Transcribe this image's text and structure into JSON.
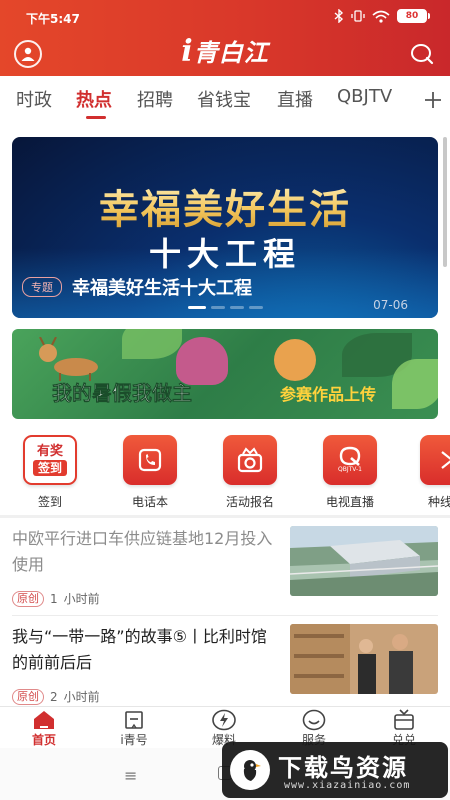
{
  "status_bar": {
    "time": "下午5:47",
    "battery": "80"
  },
  "header": {
    "logo_text": "青白江",
    "logo_prefix": "i"
  },
  "tabs": [
    {
      "label": "时政",
      "active": false
    },
    {
      "label": "热点",
      "active": true
    },
    {
      "label": "招聘",
      "active": false
    },
    {
      "label": "省钱宝",
      "active": false
    },
    {
      "label": "直播",
      "active": false
    },
    {
      "label": "QBJTV",
      "active": false
    }
  ],
  "banner": {
    "headline_line1": "幸福美好生活",
    "headline_line2": "十大工程",
    "tag": "专题",
    "caption": "幸福美好生活十大工程",
    "date": "07-06"
  },
  "promo": {
    "title": "我的暑假我做主",
    "subtitle": "参赛作品上传"
  },
  "quick_entries": [
    {
      "label": "签到",
      "icon": "reward-checkin-icon",
      "icon_top": "有奖",
      "icon_bottom": "签到"
    },
    {
      "label": "电话本",
      "icon": "phonebook-icon"
    },
    {
      "label": "活动报名",
      "icon": "activity-signup-icon"
    },
    {
      "label": "电视直播",
      "icon": "tv-live-icon",
      "icon_text": "QBJTV-1"
    },
    {
      "label": "种线",
      "icon": "more-icon"
    }
  ],
  "news": [
    {
      "headline": "中欧平行进口车供应链基地12月投入使用",
      "tag": "原创",
      "comments": "1",
      "time": "小时前",
      "read": true
    },
    {
      "headline": "我与“一带一路”的故事⑤丨比利时馆的前前后后",
      "tag": "原创",
      "comments": "2",
      "time": "小时前",
      "read": false
    }
  ],
  "bottom_nav": [
    {
      "label": "首页",
      "icon": "home-icon",
      "active": true
    },
    {
      "label": "i青号",
      "icon": "bookmark-icon",
      "active": false
    },
    {
      "label": "爆料",
      "icon": "lightning-icon",
      "active": false
    },
    {
      "label": "服务",
      "icon": "smile-icon",
      "active": false
    },
    {
      "label": "兑兑",
      "icon": "tv-gift-icon",
      "active": false
    }
  ],
  "system_nav": {
    "menu_glyph": "≡"
  },
  "watermark": {
    "text": "下载鸟资源",
    "url": "www.xiazainiao.com"
  },
  "colors": {
    "brand": "#d12f2f",
    "header_gradient_start": "#e4472a",
    "header_gradient_end": "#c9282b"
  }
}
